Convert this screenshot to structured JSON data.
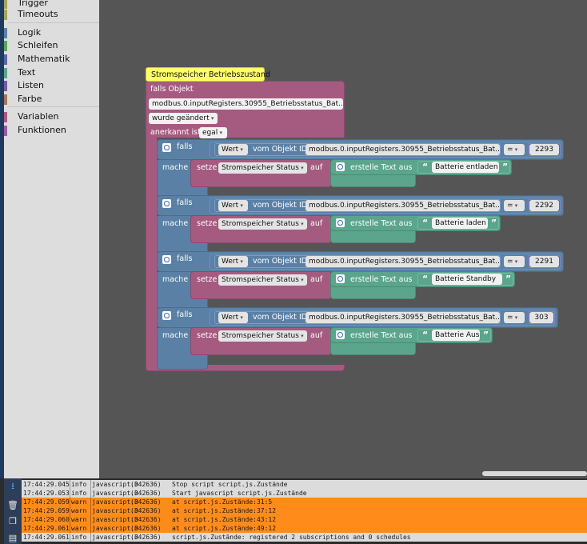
{
  "toolbox": {
    "categories": [
      {
        "label": "Trigger",
        "color": "#a5a55b"
      },
      {
        "label": "Timeouts",
        "color": "#a5a55b"
      },
      {
        "label": "Logik",
        "color": "#5b80a5"
      },
      {
        "label": "Schleifen",
        "color": "#5ba55b"
      },
      {
        "label": "Mathematik",
        "color": "#5b67a5"
      },
      {
        "label": "Text",
        "color": "#5ba58c"
      },
      {
        "label": "Listen",
        "color": "#745ba5"
      },
      {
        "label": "Farbe",
        "color": "#a5745b"
      },
      {
        "label": "Variablen",
        "color": "#a55b80"
      },
      {
        "label": "Funktionen",
        "color": "#995ba5"
      }
    ]
  },
  "blocks": {
    "comment": "Stromspeicher Betriebszustand",
    "trigger": {
      "label": "falls Objekt",
      "object_id": "modbus.0.inputRegisters.30955_Betriebsstatus_Bat...",
      "change": "wurde geändert",
      "ack_label": "anerkannt ist",
      "ack_value": "egal"
    },
    "conditions": [
      {
        "falls": "falls",
        "wert": "Wert",
        "vom_objekt": "vom Objekt ID",
        "object_id": "modbus.0.inputRegisters.30955_Betriebsstatus_Bat...",
        "op": "=",
        "value": "2293",
        "mache": "mache",
        "setze": "setze",
        "variable": "Stromspeicher Status",
        "auf": "auf",
        "create_text": "erstelle Text aus",
        "text": "Batterie entladen"
      },
      {
        "falls": "falls",
        "wert": "Wert",
        "vom_objekt": "vom Objekt ID",
        "object_id": "modbus.0.inputRegisters.30955_Betriebsstatus_Bat...",
        "op": "=",
        "value": "2292",
        "mache": "mache",
        "setze": "setze",
        "variable": "Stromspeicher Status",
        "auf": "auf",
        "create_text": "erstelle Text aus",
        "text": "Batterie laden"
      },
      {
        "falls": "falls",
        "wert": "Wert",
        "vom_objekt": "vom Objekt ID",
        "object_id": "modbus.0.inputRegisters.30955_Betriebsstatus_Bat...",
        "op": "=",
        "value": "2291",
        "mache": "mache",
        "setze": "setze",
        "variable": "Stromspeicher Status",
        "auf": "auf",
        "create_text": "erstelle Text aus",
        "text": "Batterie Standby"
      },
      {
        "falls": "falls",
        "wert": "Wert",
        "vom_objekt": "vom Objekt ID",
        "object_id": "modbus.0.inputRegisters.30955_Betriebsstatus_Bat...",
        "op": "=",
        "value": "303",
        "mache": "mache",
        "setze": "setze",
        "variable": "Stromspeicher Status",
        "auf": "auf",
        "create_text": "erstelle Text aus",
        "text": "Batterie Aus"
      }
    ],
    "quote_open": "“",
    "quote_close": "”"
  },
  "log": {
    "icons": [
      "download-icon",
      "trash-icon",
      "copy-icon",
      "terminal-icon"
    ],
    "rows": [
      {
        "time": "17:44:29.045",
        "severity": "info",
        "source": "javascript.0",
        "pid": "(342636)",
        "message": "Stop script script.js.Zustände"
      },
      {
        "time": "17:44:29.053",
        "severity": "info",
        "source": "javascript.0",
        "pid": "(342636)",
        "message": "Start javascript script.js.Zustände"
      },
      {
        "time": "17:44:29.059",
        "severity": "warn",
        "source": "javascript.0",
        "pid": "(342636)",
        "message": "at script.js.Zustände:31:5"
      },
      {
        "time": "17:44:29.059",
        "severity": "warn",
        "source": "javascript.0",
        "pid": "(342636)",
        "message": "at script.js.Zustände:37:12"
      },
      {
        "time": "17:44:29.060",
        "severity": "warn",
        "source": "javascript.0",
        "pid": "(342636)",
        "message": "at script.js.Zustände:43:12"
      },
      {
        "time": "17:44:29.061",
        "severity": "warn",
        "source": "javascript.0",
        "pid": "(342636)",
        "message": "at script.js.Zustände:49:12"
      },
      {
        "time": "17:44:29.061",
        "severity": "info",
        "source": "javascript.0",
        "pid": "(342636)",
        "message": "script.js.Zustände: registered 2 subscriptions and 0 schedules"
      }
    ]
  },
  "colors": {
    "event_block": "#a55b80",
    "logic_block": "#5b80a5",
    "text_block": "#5ba58c",
    "comment": "#ffff66",
    "warn": "#ff8c1a"
  }
}
